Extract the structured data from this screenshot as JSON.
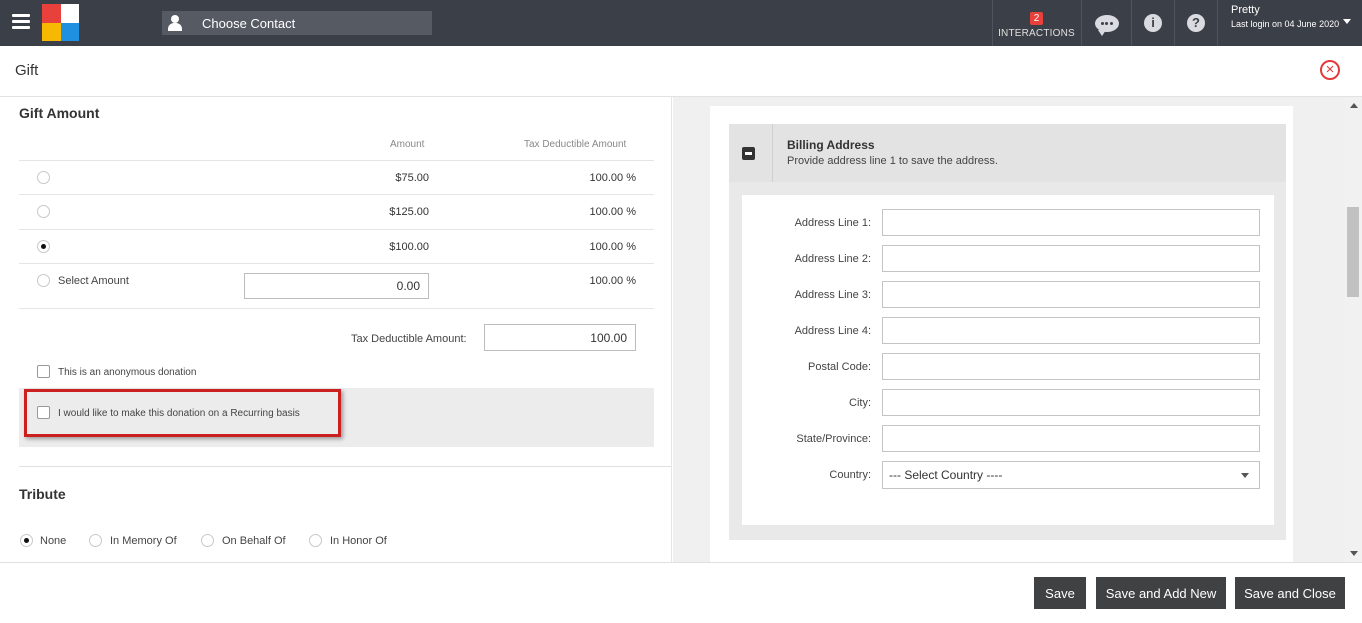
{
  "topbar": {
    "contact_placeholder": "Choose Contact",
    "interactions_count": "2",
    "interactions_label": "INTERACTIONS",
    "user_name": "Pretty",
    "last_login": "Last login on 04 June 2020",
    "info_glyph": "i",
    "help_glyph": "?"
  },
  "page": {
    "title": "Gift",
    "close_glyph": "×"
  },
  "gift_amount": {
    "title": "Gift Amount",
    "col_amount": "Amount",
    "col_tax": "Tax Deductible Amount",
    "options": [
      {
        "amount": "$75.00",
        "tax": "100.00 %",
        "selected": false
      },
      {
        "amount": "$125.00",
        "tax": "100.00 %",
        "selected": false
      },
      {
        "amount": "$100.00",
        "tax": "100.00 %",
        "selected": true
      }
    ],
    "select_amount_label": "Select Amount",
    "select_amount_value": "0.00",
    "select_amount_tax": "100.00 %",
    "tax_deductible_label": "Tax Deductible Amount:",
    "tax_deductible_value": "100.00",
    "anonymous_label": "This is an anonymous donation",
    "recurring_label": "I would like to make this donation on a Recurring basis"
  },
  "tribute": {
    "title": "Tribute",
    "options": [
      "None",
      "In Memory Of",
      "On Behalf Of",
      "In Honor Of"
    ],
    "selected": "None"
  },
  "billing": {
    "title": "Billing Address",
    "subtitle": "Provide address line 1 to save the address.",
    "fields": [
      "Address Line 1:",
      "Address Line 2:",
      "Address Line 3:",
      "Address Line 4:",
      "Postal Code:",
      "City:",
      "State/Province:"
    ],
    "country_label": "Country:",
    "country_value": "--- Select Country ----"
  },
  "footer": {
    "save": "Save",
    "save_add_new": "Save and Add New",
    "save_close": "Save and Close"
  }
}
